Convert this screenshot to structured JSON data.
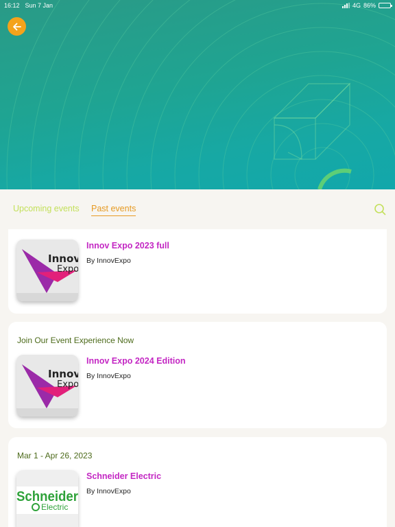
{
  "status_bar": {
    "time": "16:12",
    "date": "Sun 7 Jan",
    "network": "4G",
    "battery": "86%",
    "battery_level": 0.86
  },
  "header": {
    "back_icon": "arrow-left-icon",
    "accent_color": "#f4a31b"
  },
  "tabs": {
    "upcoming": "Upcoming events",
    "past": "Past events",
    "active": "past",
    "search_icon": "search-icon"
  },
  "events": [
    {
      "date": "",
      "title": "Innov Expo 2023 full",
      "by": "By InnovExpo",
      "logo_line1": "Innov",
      "logo_line2": "Expo"
    },
    {
      "date": "Join Our Event Experience Now",
      "title": "Innov Expo 2024 Edition",
      "by": "By InnovExpo",
      "logo_line1": "Innov",
      "logo_line2": "Expo"
    },
    {
      "date": "Mar 1 - Apr 26, 2023",
      "title": "Schneider Electric",
      "by": "By InnovExpo",
      "logo_line1": "Schneider",
      "logo_line2": "Electric"
    }
  ],
  "colors": {
    "title": "#c327c3",
    "date": "#4c6a1a",
    "tab_active": "#e69a23",
    "tab_inactive": "#c3e05a"
  }
}
